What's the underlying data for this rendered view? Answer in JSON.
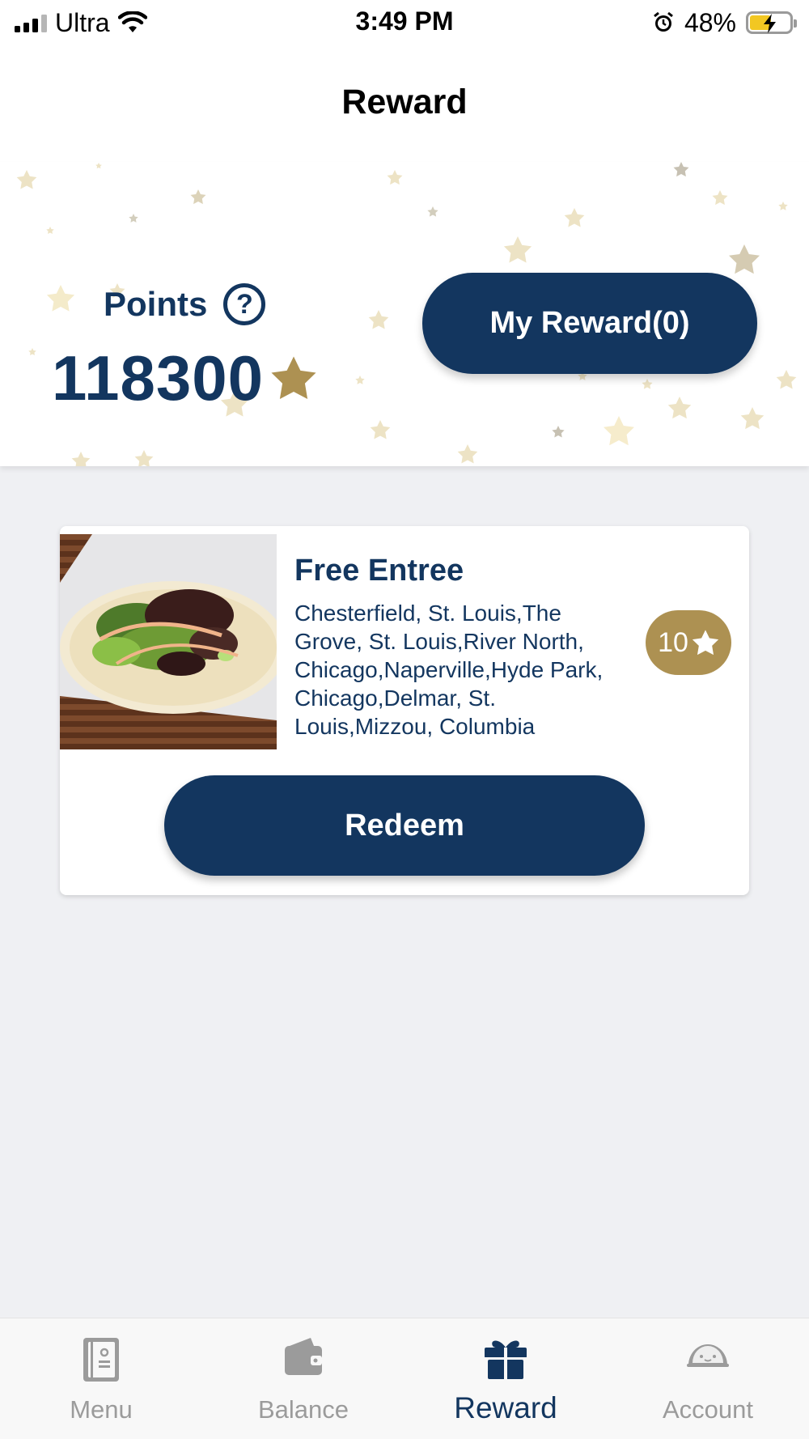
{
  "status_bar": {
    "carrier": "Ultra",
    "time": "3:49 PM",
    "battery": "48%",
    "battery_level": 0.48,
    "icons": [
      "signal-icon",
      "wifi-icon",
      "alarm-icon",
      "battery-charging-icon"
    ]
  },
  "header": {
    "title": "Reward"
  },
  "points": {
    "label": "Points",
    "help_icon": "?",
    "value": "118300",
    "my_reward_label": "My Reward(0)"
  },
  "reward_card": {
    "title": "Free Entree",
    "description": "Chesterfield, St. Louis,The Grove, St. Louis,River North, Chicago,Naperville,Hyde Park, Chicago,Delmar, St. Louis,Mizzou, Columbia",
    "cost": "10",
    "redeem_label": "Redeem"
  },
  "tab_bar": {
    "tabs": [
      {
        "label": "Menu",
        "icon": "menu-book-icon"
      },
      {
        "label": "Balance",
        "icon": "wallet-icon"
      },
      {
        "label": "Reward",
        "icon": "gift-icon",
        "active": true
      },
      {
        "label": "Account",
        "icon": "taco-icon"
      }
    ]
  },
  "colors": {
    "primary": "#13365f",
    "gold": "#ad9152",
    "background": "#eff0f3",
    "inactive": "#9b9b9b"
  }
}
